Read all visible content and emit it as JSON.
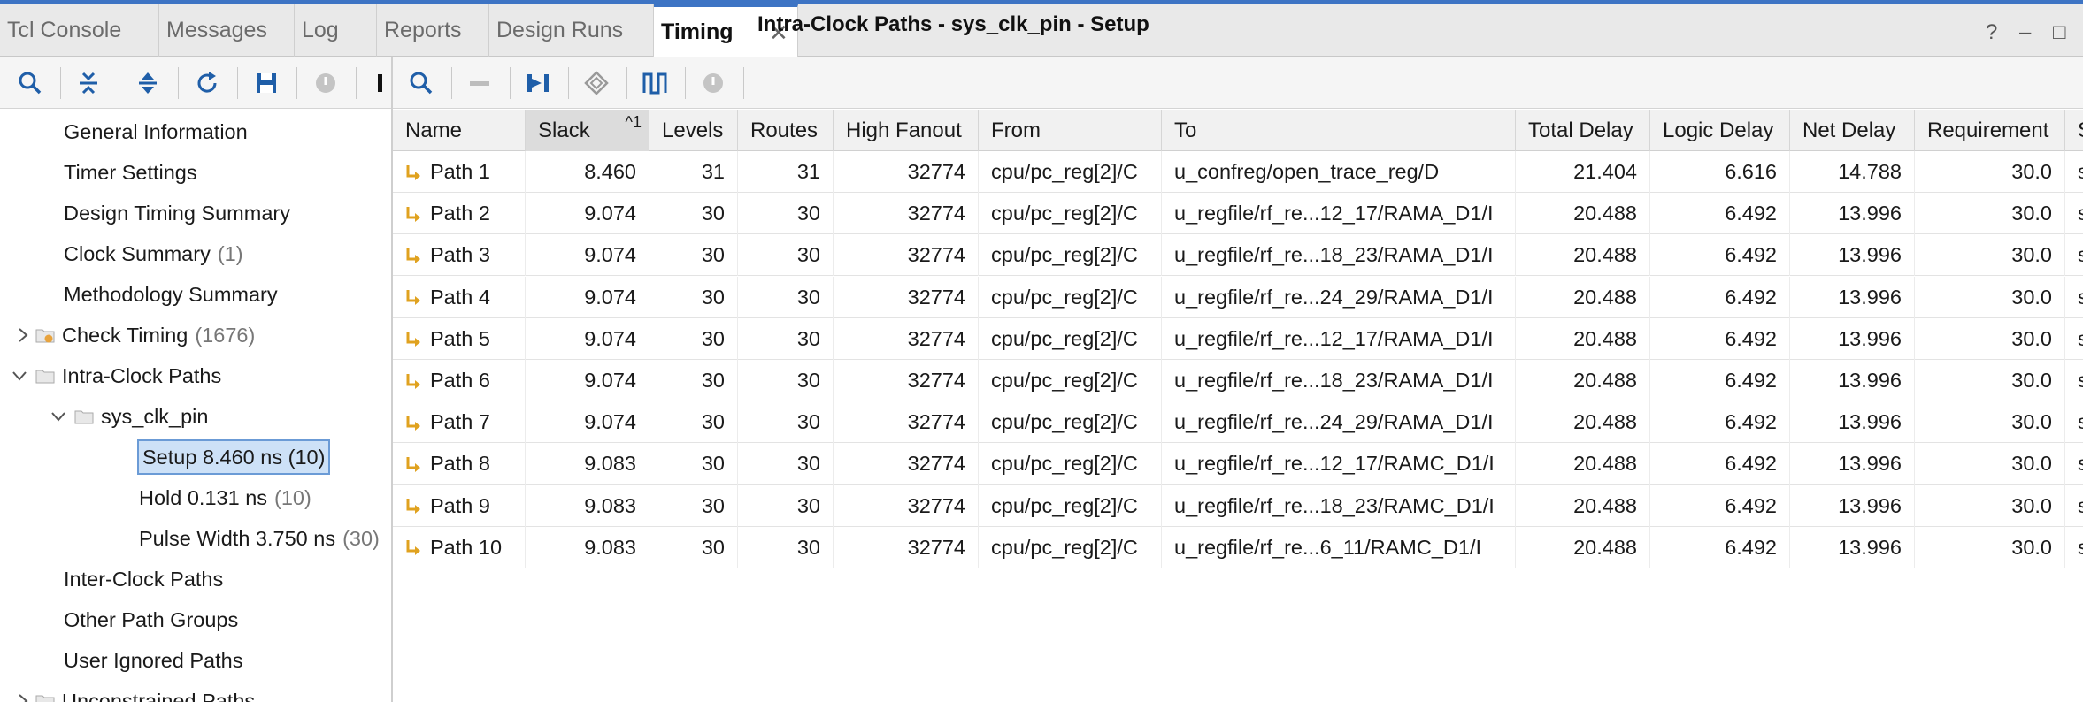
{
  "tabs": [
    {
      "label": "Tcl Console"
    },
    {
      "label": "Messages"
    },
    {
      "label": "Log"
    },
    {
      "label": "Reports"
    },
    {
      "label": "Design Runs"
    },
    {
      "label": "Timing",
      "active": true
    }
  ],
  "window_controls": {
    "help": "?",
    "minimize": "–",
    "maximize": "□"
  },
  "icons": {
    "search": "search-icon",
    "collapse_all": "collapse-all-icon",
    "expand_all": "expand-all-icon",
    "refresh": "refresh-icon",
    "save": "save-icon",
    "stop": "stop-icon",
    "path": "path-arrow-icon"
  },
  "results": {
    "title": "Intra-Clock Paths - sys_clk_pin - Setup"
  },
  "tree": {
    "items": [
      {
        "label": "General Information",
        "count": ""
      },
      {
        "label": "Timer Settings",
        "count": ""
      },
      {
        "label": "Design Timing Summary",
        "count": ""
      },
      {
        "label": "Clock Summary",
        "count": "(1)"
      },
      {
        "label": "Methodology Summary",
        "count": ""
      },
      {
        "label": "Check Timing",
        "count": "(1676)"
      },
      {
        "label": "Intra-Clock Paths",
        "count": ""
      },
      {
        "label": "sys_clk_pin",
        "count": ""
      },
      {
        "label": "Setup 8.460 ns (10)",
        "count": ""
      },
      {
        "label": "Hold 0.131 ns",
        "count": "(10)"
      },
      {
        "label": "Pulse Width 3.750 ns",
        "count": "(30)"
      },
      {
        "label": "Inter-Clock Paths",
        "count": ""
      },
      {
        "label": "Other Path Groups",
        "count": ""
      },
      {
        "label": "User Ignored Paths",
        "count": ""
      },
      {
        "label": "Unconstrained Paths",
        "count": ""
      }
    ]
  },
  "table": {
    "sort_indicator": "^1",
    "columns": [
      "Name",
      "Slack",
      "Levels",
      "Routes",
      "High Fanout",
      "From",
      "To",
      "Total Delay",
      "Logic Delay",
      "Net Delay",
      "Requirement",
      "S"
    ],
    "rows": [
      [
        "Path 1",
        "8.460",
        "31",
        "31",
        "32774",
        "cpu/pc_reg[2]/C",
        "u_confreg/open_trace_reg/D",
        "21.404",
        "6.616",
        "14.788",
        "30.0",
        "s"
      ],
      [
        "Path 2",
        "9.074",
        "30",
        "30",
        "32774",
        "cpu/pc_reg[2]/C",
        "u_regfile/rf_re...12_17/RAMA_D1/I",
        "20.488",
        "6.492",
        "13.996",
        "30.0",
        "s"
      ],
      [
        "Path 3",
        "9.074",
        "30",
        "30",
        "32774",
        "cpu/pc_reg[2]/C",
        "u_regfile/rf_re...18_23/RAMA_D1/I",
        "20.488",
        "6.492",
        "13.996",
        "30.0",
        "s"
      ],
      [
        "Path 4",
        "9.074",
        "30",
        "30",
        "32774",
        "cpu/pc_reg[2]/C",
        "u_regfile/rf_re...24_29/RAMA_D1/I",
        "20.488",
        "6.492",
        "13.996",
        "30.0",
        "s"
      ],
      [
        "Path 5",
        "9.074",
        "30",
        "30",
        "32774",
        "cpu/pc_reg[2]/C",
        "u_regfile/rf_re...12_17/RAMA_D1/I",
        "20.488",
        "6.492",
        "13.996",
        "30.0",
        "s"
      ],
      [
        "Path 6",
        "9.074",
        "30",
        "30",
        "32774",
        "cpu/pc_reg[2]/C",
        "u_regfile/rf_re...18_23/RAMA_D1/I",
        "20.488",
        "6.492",
        "13.996",
        "30.0",
        "s"
      ],
      [
        "Path 7",
        "9.074",
        "30",
        "30",
        "32774",
        "cpu/pc_reg[2]/C",
        "u_regfile/rf_re...24_29/RAMA_D1/I",
        "20.488",
        "6.492",
        "13.996",
        "30.0",
        "s"
      ],
      [
        "Path 8",
        "9.083",
        "30",
        "30",
        "32774",
        "cpu/pc_reg[2]/C",
        "u_regfile/rf_re...12_17/RAMC_D1/I",
        "20.488",
        "6.492",
        "13.996",
        "30.0",
        "s"
      ],
      [
        "Path 9",
        "9.083",
        "30",
        "30",
        "32774",
        "cpu/pc_reg[2]/C",
        "u_regfile/rf_re...18_23/RAMC_D1/I",
        "20.488",
        "6.492",
        "13.996",
        "30.0",
        "s"
      ],
      [
        "Path 10",
        "9.083",
        "30",
        "30",
        "32774",
        "cpu/pc_reg[2]/C",
        "u_regfile/rf_re...6_11/RAMC_D1/I",
        "20.488",
        "6.492",
        "13.996",
        "30.0",
        "s"
      ]
    ]
  }
}
